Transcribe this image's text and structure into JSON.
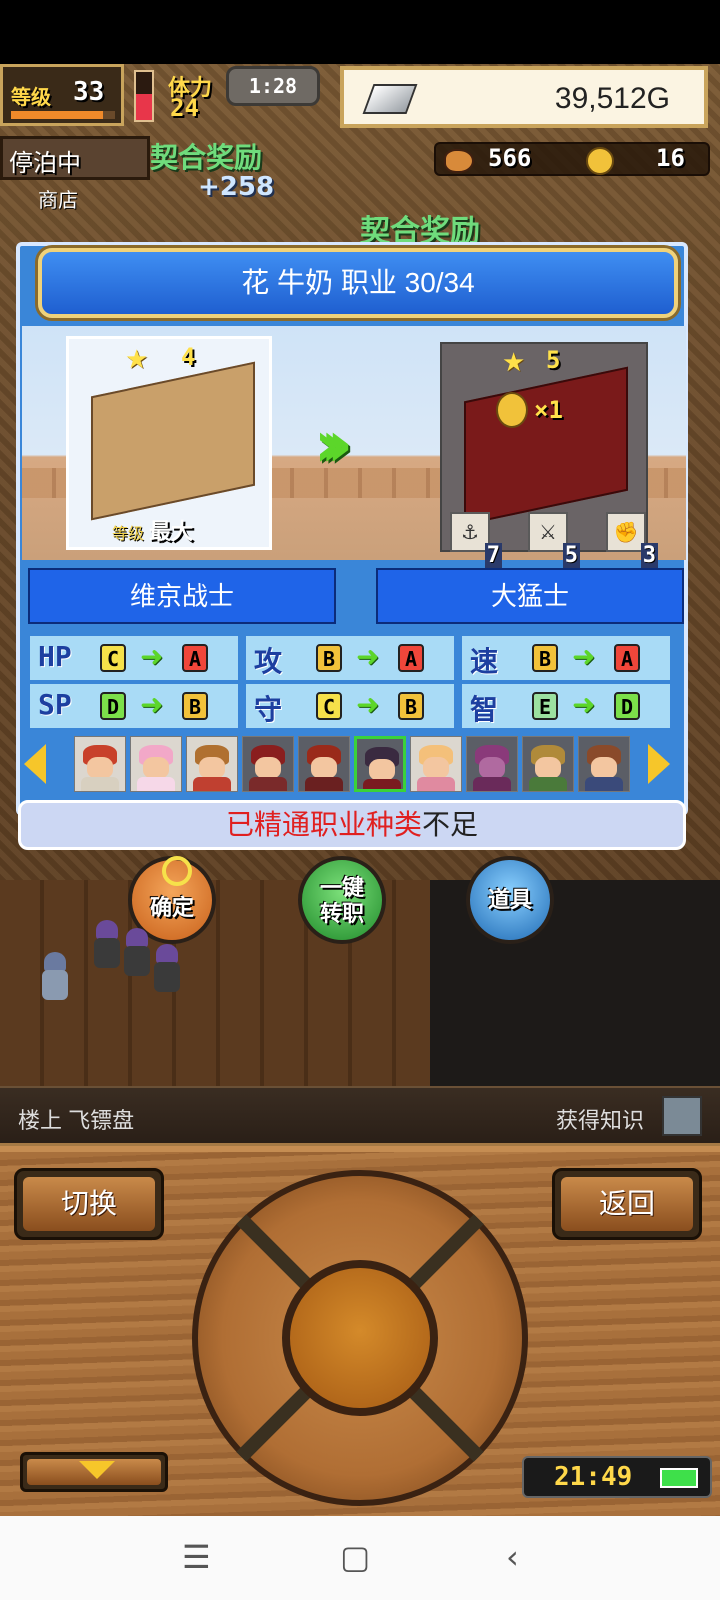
{
  "hud": {
    "level_label": "等级",
    "level_value": "33",
    "level_bar_fraction": 0.88,
    "stamina_fraction": 0.55,
    "stamina_label": "体力",
    "stamina_value": "24",
    "timer": "1:28",
    "gold": "39,512G",
    "docked": "停泊中",
    "shop": "商店",
    "bond_reward": "契合奖励",
    "bond_bonus": "+258",
    "resource_a": "566",
    "resource_b": "16"
  },
  "dialog": {
    "title": "花 牛奶  职业 30/34",
    "from": {
      "stars": "4",
      "level_label": "等级",
      "level_value": "最大",
      "job": "维京战士"
    },
    "to": {
      "stars": "5",
      "coin_mult": "×1",
      "skills": [
        {
          "icon": "anchor-icon",
          "value": "7"
        },
        {
          "icon": "sword-icon",
          "value": "5"
        },
        {
          "icon": "fist-icon",
          "value": "3"
        }
      ],
      "job": "大猛士"
    },
    "stats": [
      {
        "key": "HP",
        "from": "C",
        "to": "A"
      },
      {
        "key": "攻",
        "from": "B",
        "to": "A"
      },
      {
        "key": "速",
        "from": "B",
        "to": "A"
      },
      {
        "key": "SP",
        "from": "D",
        "to": "B"
      },
      {
        "key": "守",
        "from": "C",
        "to": "B"
      },
      {
        "key": "智",
        "from": "E",
        "to": "D"
      }
    ],
    "message_red": "已精通职业种类",
    "message_black": "不足"
  },
  "actions": {
    "confirm": "确定",
    "onekey_line1": "一键",
    "onekey_line2": "转职",
    "items": "道具"
  },
  "info": {
    "location": "楼上 飞镖盘",
    "gain": "获得知识"
  },
  "controls": {
    "switch": "切换",
    "back": "返回",
    "clock": "21:49"
  },
  "colors": {
    "grade_A": "#f0463a",
    "grade_B": "#f2c23a",
    "grade_C": "#f6e14a",
    "grade_D": "#7ce04a",
    "grade_E": "#9ce0a0"
  }
}
